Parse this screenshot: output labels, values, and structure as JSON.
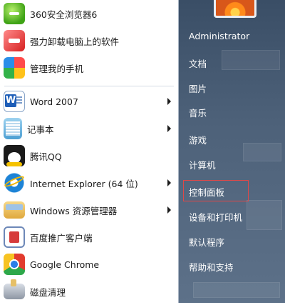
{
  "programs": [
    {
      "label": "360安全浏览器6",
      "icon": "browser-360-icon",
      "submenu": false
    },
    {
      "label": "强力卸载电脑上的软件",
      "icon": "uninstall-icon",
      "submenu": false
    },
    {
      "label": "管理我的手机",
      "icon": "phone-manager-icon",
      "submenu": false
    },
    {
      "label": "Word 2007",
      "icon": "word-icon",
      "submenu": true
    },
    {
      "label": "记事本",
      "icon": "notepad-icon",
      "submenu": true
    },
    {
      "label": "腾讯QQ",
      "icon": "qq-icon",
      "submenu": false
    },
    {
      "label": "Internet Explorer (64 位)",
      "icon": "ie-icon",
      "submenu": true
    },
    {
      "label": "Windows 资源管理器",
      "icon": "explorer-icon",
      "submenu": true
    },
    {
      "label": "百度推广客户端",
      "icon": "baidu-client-icon",
      "submenu": false
    },
    {
      "label": "Google Chrome",
      "icon": "chrome-icon",
      "submenu": false
    },
    {
      "label": "磁盘清理",
      "icon": "disk-cleanup-icon",
      "submenu": false
    }
  ],
  "right_items": [
    {
      "label": "Administrator"
    },
    {
      "label": "文档"
    },
    {
      "label": "图片"
    },
    {
      "label": "音乐"
    },
    {
      "label": "游戏"
    },
    {
      "label": "计算机"
    },
    {
      "label": "控制面板"
    },
    {
      "label": "设备和打印机"
    },
    {
      "label": "默认程序"
    },
    {
      "label": "帮助和支持"
    }
  ],
  "colors": {
    "highlight": "#e04848",
    "right_pane": "#4d6179"
  }
}
